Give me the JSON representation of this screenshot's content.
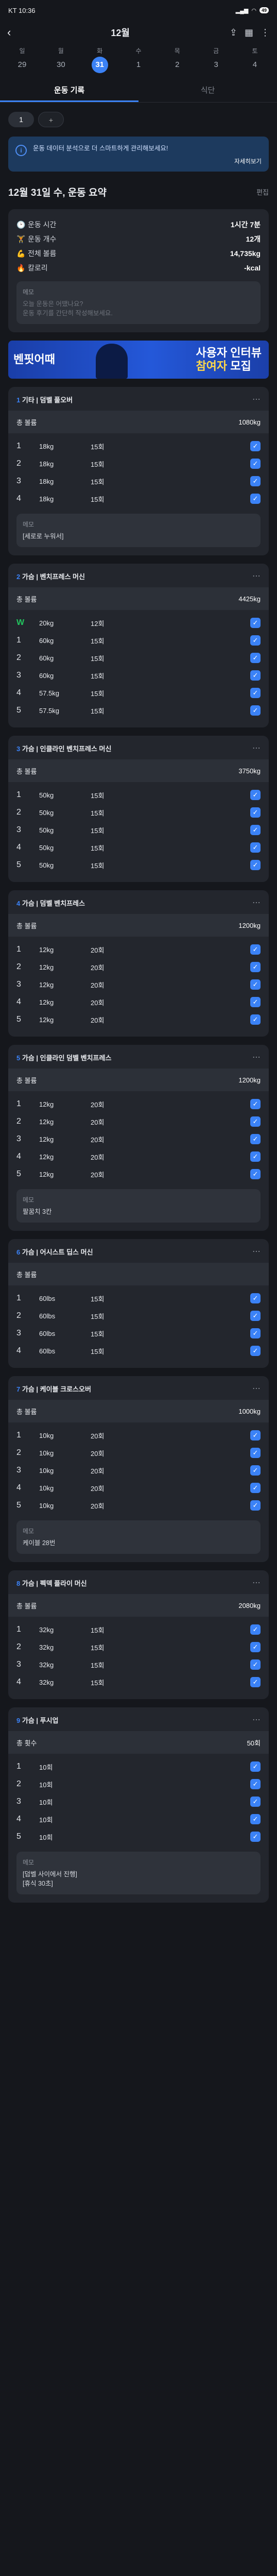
{
  "status": {
    "time": "KT 10:36",
    "battery": "49"
  },
  "header": {
    "title": "12월"
  },
  "week": [
    {
      "name": "일",
      "date": "29",
      "selected": false
    },
    {
      "name": "월",
      "date": "30",
      "selected": false
    },
    {
      "name": "화",
      "date": "31",
      "selected": true
    },
    {
      "name": "수",
      "date": "1",
      "selected": false
    },
    {
      "name": "목",
      "date": "2",
      "selected": false
    },
    {
      "name": "금",
      "date": "3",
      "selected": false
    },
    {
      "name": "토",
      "date": "4",
      "selected": false
    }
  ],
  "tabs": [
    {
      "label": "운동 기록"
    },
    {
      "label": "식단"
    }
  ],
  "chips": {
    "first": "1",
    "add": "+"
  },
  "banner": {
    "text": "운동 데이터 분석으로 더 스마트하게 관리해보세요!",
    "link": "자세히보기"
  },
  "summary": {
    "title": "12월 31일 수, 운동 요약",
    "edit": "편집",
    "rows": [
      {
        "icon": "🕑",
        "label": "운동 시간",
        "value": "1시간 7분"
      },
      {
        "icon": "🏋",
        "label": "운동 개수",
        "value": "12개"
      },
      {
        "icon": "💪",
        "label": "전체 볼륨",
        "value": "14,735kg"
      },
      {
        "icon": "🔥",
        "label": "칼로리",
        "value": "-kcal"
      }
    ],
    "memo_title": "메모",
    "memo_placeholder": "오늘 운동은 어땠나요?\n운동 후기를 간단히 작성해보세요."
  },
  "ad": {
    "left": "벤핏어때",
    "right_top": "사용자 인터뷰",
    "right_bottom_a": "참여자",
    "right_bottom_b": " 모집"
  },
  "exercises": [
    {
      "num": "1",
      "name": "기타 | 덤벨 풀오버",
      "vol_label": "총 볼륨",
      "vol": "1080kg",
      "sets": [
        [
          "1",
          "18kg",
          "15회"
        ],
        [
          "2",
          "18kg",
          "15회"
        ],
        [
          "3",
          "18kg",
          "15회"
        ],
        [
          "4",
          "18kg",
          "15회"
        ]
      ],
      "memo_title": "메모",
      "memo": "[세로로 누워서]"
    },
    {
      "num": "2",
      "name": "가슴 | 벤치프레스 머신",
      "vol_label": "총 볼륨",
      "vol": "4425kg",
      "sets": [
        [
          "W",
          "20kg",
          "12회"
        ],
        [
          "1",
          "60kg",
          "15회"
        ],
        [
          "2",
          "60kg",
          "15회"
        ],
        [
          "3",
          "60kg",
          "15회"
        ],
        [
          "4",
          "57.5kg",
          "15회"
        ],
        [
          "5",
          "57.5kg",
          "15회"
        ]
      ]
    },
    {
      "num": "3",
      "name": "가슴 | 인클라인 벤치프레스 머신",
      "vol_label": "총 볼륨",
      "vol": "3750kg",
      "sets": [
        [
          "1",
          "50kg",
          "15회"
        ],
        [
          "2",
          "50kg",
          "15회"
        ],
        [
          "3",
          "50kg",
          "15회"
        ],
        [
          "4",
          "50kg",
          "15회"
        ],
        [
          "5",
          "50kg",
          "15회"
        ]
      ]
    },
    {
      "num": "4",
      "name": "가슴 | 덤벨 벤치프레스",
      "vol_label": "총 볼륨",
      "vol": "1200kg",
      "sets": [
        [
          "1",
          "12kg",
          "20회"
        ],
        [
          "2",
          "12kg",
          "20회"
        ],
        [
          "3",
          "12kg",
          "20회"
        ],
        [
          "4",
          "12kg",
          "20회"
        ],
        [
          "5",
          "12kg",
          "20회"
        ]
      ]
    },
    {
      "num": "5",
      "name": "가슴 | 인클라인 덤벨 벤치프레스",
      "vol_label": "총 볼륨",
      "vol": "1200kg",
      "sets": [
        [
          "1",
          "12kg",
          "20회"
        ],
        [
          "2",
          "12kg",
          "20회"
        ],
        [
          "3",
          "12kg",
          "20회"
        ],
        [
          "4",
          "12kg",
          "20회"
        ],
        [
          "5",
          "12kg",
          "20회"
        ]
      ],
      "memo_title": "메모",
      "memo": "팔꿈치 3칸"
    },
    {
      "num": "6",
      "name": "가슴 | 어시스트 딥스 머신",
      "vol_label": "총 볼륨",
      "vol": "",
      "sets": [
        [
          "1",
          "60lbs",
          "15회"
        ],
        [
          "2",
          "60lbs",
          "15회"
        ],
        [
          "3",
          "60lbs",
          "15회"
        ],
        [
          "4",
          "60lbs",
          "15회"
        ]
      ]
    },
    {
      "num": "7",
      "name": "가슴 | 케이블 크로스오버",
      "vol_label": "총 볼륨",
      "vol": "1000kg",
      "sets": [
        [
          "1",
          "10kg",
          "20회"
        ],
        [
          "2",
          "10kg",
          "20회"
        ],
        [
          "3",
          "10kg",
          "20회"
        ],
        [
          "4",
          "10kg",
          "20회"
        ],
        [
          "5",
          "10kg",
          "20회"
        ]
      ],
      "memo_title": "메모",
      "memo": "케이블 28번"
    },
    {
      "num": "8",
      "name": "가슴 | 펙덱 플라이 머신",
      "vol_label": "총 볼륨",
      "vol": "2080kg",
      "sets": [
        [
          "1",
          "32kg",
          "15회"
        ],
        [
          "2",
          "32kg",
          "15회"
        ],
        [
          "3",
          "32kg",
          "15회"
        ],
        [
          "4",
          "32kg",
          "15회"
        ]
      ]
    },
    {
      "num": "9",
      "name": "가슴 | 푸시업",
      "vol_label": "총 횟수",
      "vol": "50회",
      "sets": [
        [
          "1",
          "10회",
          ""
        ],
        [
          "2",
          "10회",
          ""
        ],
        [
          "3",
          "10회",
          ""
        ],
        [
          "4",
          "10회",
          ""
        ],
        [
          "5",
          "10회",
          ""
        ]
      ],
      "memo_title": "메모",
      "memo": "[덤벨 사이에서 진행]\n[휴식 30초]"
    }
  ]
}
